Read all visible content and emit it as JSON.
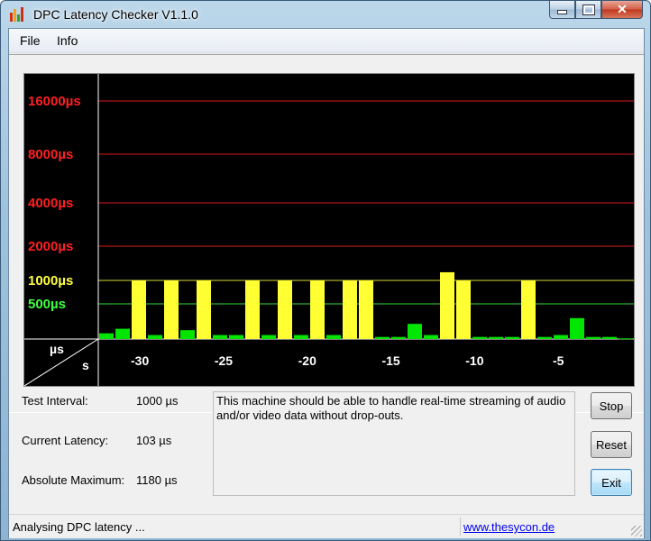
{
  "window": {
    "title": "DPC Latency Checker V1.1.0",
    "icon": "bar-chart-app-icon",
    "controls": [
      "minimize-icon",
      "maximize-icon",
      "close-icon"
    ]
  },
  "menu": [
    "File",
    "Info"
  ],
  "chart_data": {
    "type": "bar",
    "y_scale": "log",
    "y_ticks": [
      {
        "label": "16000µs",
        "value": 16000,
        "color": "#ff2020"
      },
      {
        "label": "8000µs",
        "value": 8000,
        "color": "#ff2020"
      },
      {
        "label": "4000µs",
        "value": 4000,
        "color": "#ff2020"
      },
      {
        "label": "2000µs",
        "value": 2000,
        "color": "#ff2020"
      },
      {
        "label": "1000µs",
        "value": 1000,
        "color": "#ffff40"
      },
      {
        "label": "500µs",
        "value": 500,
        "color": "#40ff40"
      }
    ],
    "x_ticks": [
      "-30",
      "-25",
      "-20",
      "-15",
      "-10",
      "-5"
    ],
    "corner_y_unit": "µs",
    "corner_x_unit": "s",
    "x_range": [
      -32,
      0
    ],
    "values": [
      130,
      160,
      1000,
      120,
      1000,
      150,
      1000,
      120,
      120,
      1000,
      120,
      1000,
      120,
      1000,
      120,
      1000,
      1000,
      110,
      110,
      200,
      120,
      1180,
      1000,
      110,
      110,
      110,
      1000,
      110,
      120,
      260,
      110,
      110,
      103
    ],
    "colors": {
      "normal": "#00e600",
      "warning": "#ffff33",
      "danger": "#ff2020"
    },
    "grid": true
  },
  "info": {
    "test_interval_label": "Test Interval:",
    "test_interval_value": "1000 µs",
    "current_latency_label": "Current Latency:",
    "current_latency_value": "103 µs",
    "absolute_maximum_label": "Absolute Maximum:",
    "absolute_maximum_value": "1180 µs"
  },
  "message": "This machine should be able to handle real-time streaming of audio and/or video data without drop-outs.",
  "buttons": {
    "stop": "Stop",
    "reset": "Reset",
    "exit": "Exit"
  },
  "status": {
    "text": "Analysing DPC latency ...",
    "link": "www.thesycon.de"
  }
}
